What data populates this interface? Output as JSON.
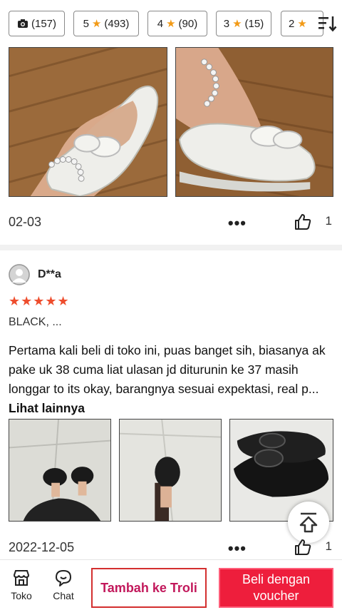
{
  "filters": [
    {
      "label": "(157)",
      "icon": "camera-icon"
    },
    {
      "label": "5",
      "count": "(493)",
      "icon": "star-icon"
    },
    {
      "label": "4",
      "count": "(90)",
      "icon": "star-icon"
    },
    {
      "label": "3",
      "count": "(15)",
      "icon": "star-icon"
    },
    {
      "label": "2",
      "count": "",
      "icon": "star-icon"
    }
  ],
  "review1": {
    "date": "02-03",
    "like_count": "1"
  },
  "review2": {
    "username": "D**a",
    "rating": 5,
    "stars": "★★★★★",
    "variant": "BLACK, ...",
    "text": "Pertama kali beli di toko ini, puas banget sih, biasanya ak pake uk 38 cuma liat ulasan jd diturunin ke 37 masih longgar to its okay, barangnya sesuai expektasi, real p...",
    "see_more": "Lihat lainnya",
    "date": "2022-12-05",
    "like_count": "1"
  },
  "bottom_bar": {
    "shop_label": "Toko",
    "chat_label": "Chat",
    "add_to_cart": "Tambah ke Troli",
    "buy": "Beli dengan voucher"
  },
  "colors": {
    "accent": "#ee4d2d",
    "buy_button": "#ee1e3c",
    "cart_border": "#d32f2f"
  }
}
